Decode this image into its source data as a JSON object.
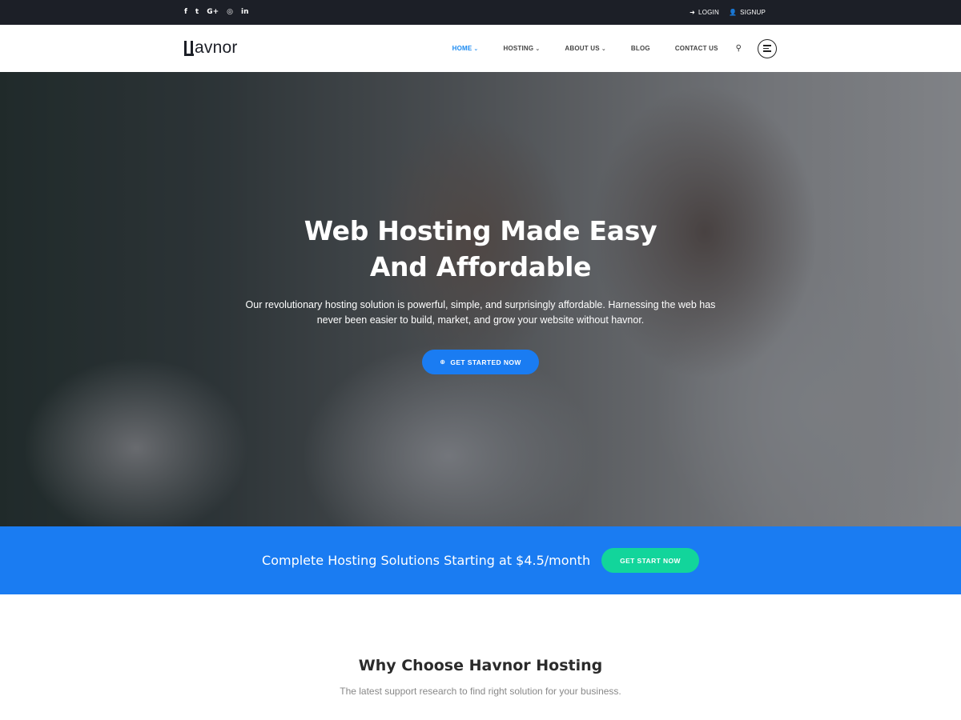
{
  "topbar": {
    "social": [
      {
        "icon": "facebook-icon",
        "glyph": "f"
      },
      {
        "icon": "twitter-icon",
        "glyph": "t"
      },
      {
        "icon": "google-plus-icon",
        "glyph": "G+"
      },
      {
        "icon": "instagram-icon",
        "glyph": "◎"
      },
      {
        "icon": "linkedin-icon",
        "glyph": "in"
      }
    ],
    "login_label": "LOGIN",
    "signup_label": "SIGNUP",
    "login_icon": "➜",
    "signup_icon": "👤"
  },
  "header": {
    "logo_text": "avnor",
    "nav": {
      "home": "HOME",
      "hosting": "HOSTING",
      "about": "ABOUT US",
      "blog": "BLOG",
      "contact": "CONTACT US"
    },
    "caret": "⌄",
    "search_icon": "⚲"
  },
  "hero": {
    "title": "Web Hosting Made Easy And Affordable",
    "text": "Our revolutionary hosting solution is powerful, simple, and surprisingly affordable.  Harnessing the web has never been easier to build, market, and grow your website without havnor.",
    "button_label": "GET STARTED NOW",
    "button_icon": "⊕"
  },
  "cta": {
    "text": "Complete Hosting Solutions Starting at $4.5/month",
    "button_label": "GET START NOW"
  },
  "why": {
    "title": "Why Choose Havnor Hosting",
    "subtitle": "The latest support research to find right solution for your business."
  },
  "colors": {
    "topbar": "#1c1f27",
    "accent": "#1a7cf2",
    "nav_active": "#1a8af2",
    "cta_button": "#12d59b"
  }
}
